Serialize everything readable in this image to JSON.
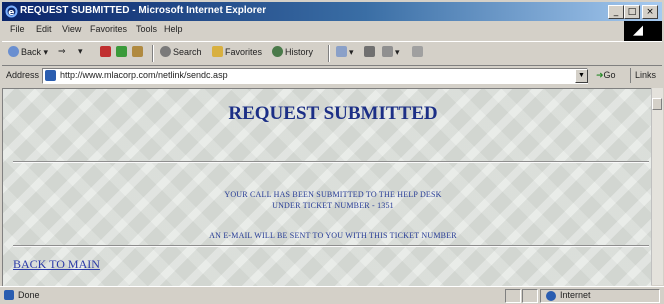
{
  "window": {
    "title": "REQUEST SUBMITTED - Microsoft Internet Explorer",
    "controls": [
      "_",
      "□",
      "×"
    ]
  },
  "menu": [
    "File",
    "Edit",
    "View",
    "Favorites",
    "Tools",
    "Help"
  ],
  "brand_glyph": "◢",
  "toolbar": {
    "back": "Back",
    "forward": "⇒",
    "search": "Search",
    "favorites": "Favorites",
    "history": "History"
  },
  "address": {
    "label": "Address",
    "url": "http://www.mlacorp.com/netlink/sendc.asp",
    "dropdown": "▼",
    "go": "Go",
    "links": "Links"
  },
  "page": {
    "heading": "REQUEST SUBMITTED",
    "message_line1": "YOUR CALL HAS BEEN SUBMITTED TO THE HELP DESK",
    "message_line2": "UNDER TICKET NUMBER - 1351",
    "email_note": "AN E-MAIL WILL BE SENT TO YOU WITH THIS TICKET NUMBER",
    "back_link": "BACK TO MAIN"
  },
  "status": {
    "text": "Done",
    "zone": "Internet"
  }
}
